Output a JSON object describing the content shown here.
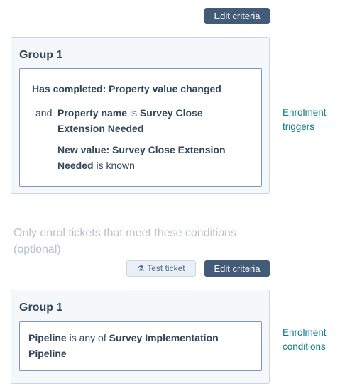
{
  "triggers": {
    "edit_label": "Edit criteria",
    "group_title": "Group 1",
    "rule_line": "Has completed: Property value changed",
    "condition1": {
      "prefix": "and",
      "prop_label": "Property name",
      "op": "is",
      "value_line1": "Survey Close",
      "value_line2": "Extension Needed"
    },
    "condition2": {
      "line1": "New value: Survey Close Extension",
      "line2_bold": "Needed",
      "line2_rest": "is known"
    },
    "side_label_line1": "Enrolment",
    "side_label_line2": "triggers"
  },
  "conditions": {
    "hint_line1": "Only enrol tickets that meet these conditions",
    "hint_line2": "(optional)",
    "test_label": "Test ticket",
    "test_icon": "flask-icon",
    "edit_label": "Edit criteria",
    "group_title": "Group 1",
    "rule": {
      "prop": "Pipeline",
      "op": "is any of",
      "value_line1": "Survey Implementation",
      "value_line2": "Pipeline"
    },
    "side_label_line1": "Enrolment",
    "side_label_line2": "conditions"
  }
}
